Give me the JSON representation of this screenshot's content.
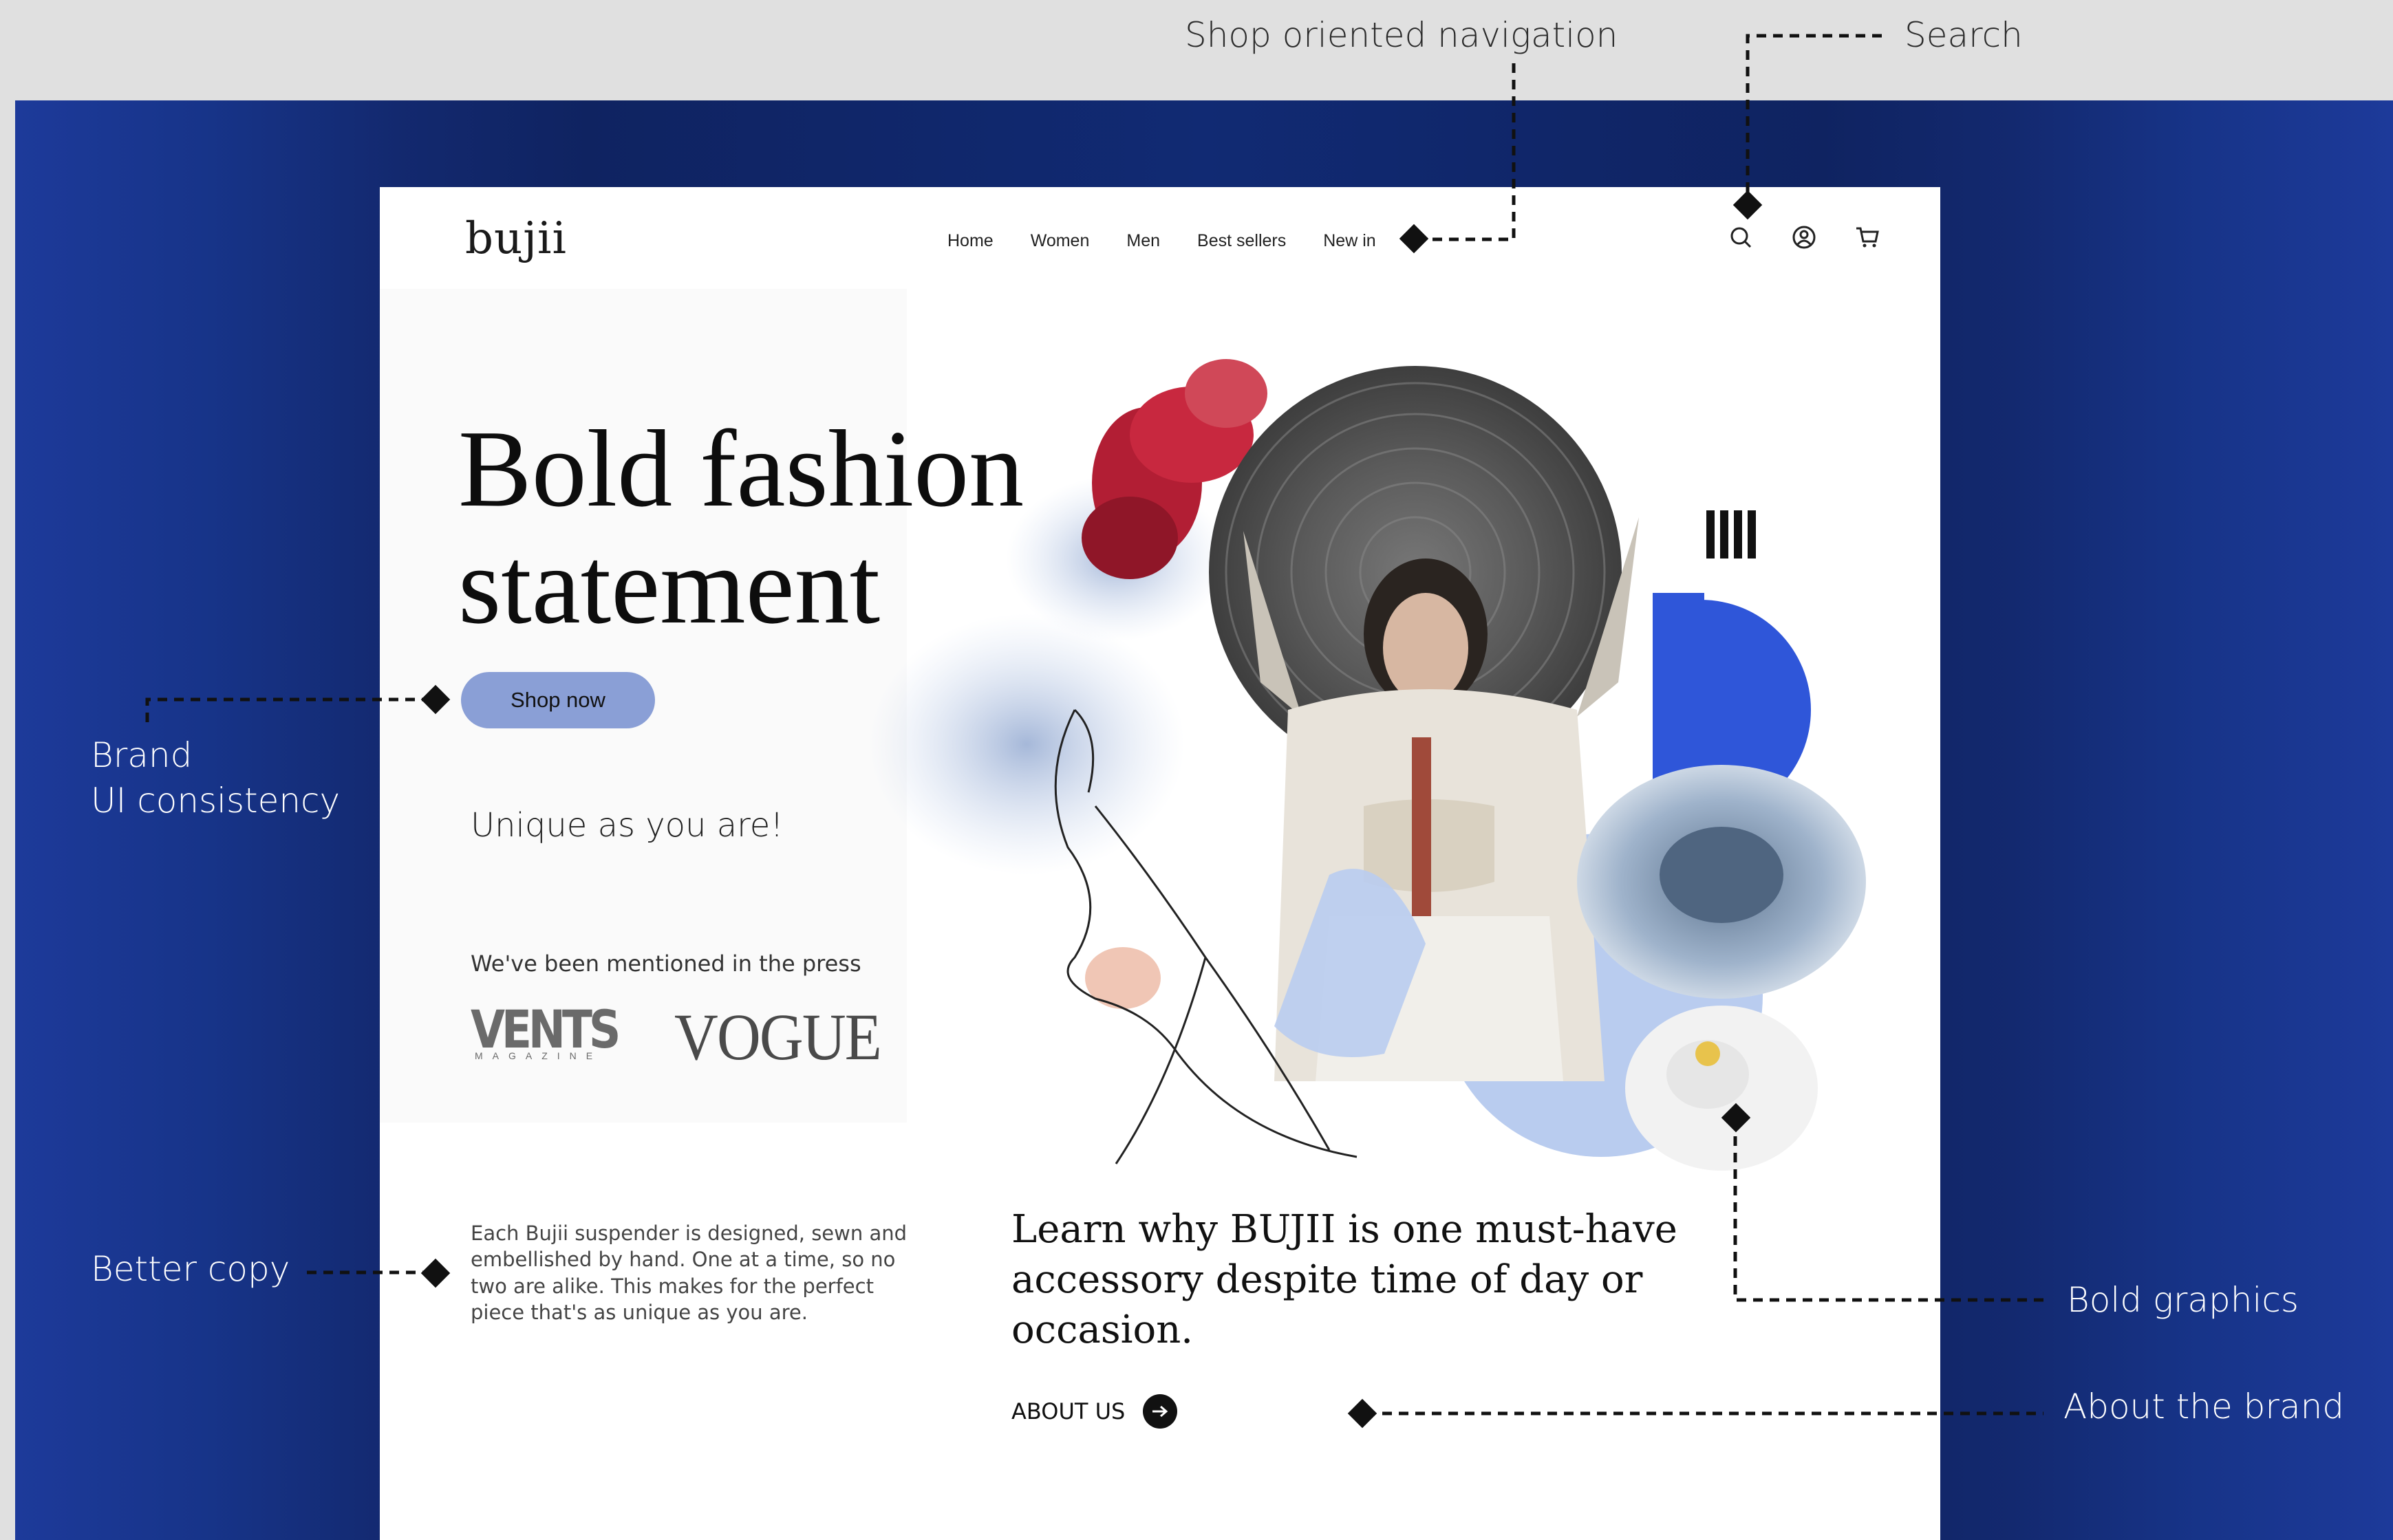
{
  "annotations": {
    "shop_nav": "Shop oriented navigation",
    "search": "Search",
    "brand_line1": "Brand",
    "brand_line2": "UI consistency",
    "better_copy": "Better copy",
    "bold_graphics": "Bold graphics",
    "about_brand": "About the brand"
  },
  "site": {
    "logo": "bujii",
    "nav": [
      "Home",
      "Women",
      "Men",
      "Best sellers",
      "New in"
    ],
    "icons": [
      "search-icon",
      "user-icon",
      "cart-icon"
    ],
    "hero": {
      "headline_line1": "Bold fashion",
      "headline_line2": "statement",
      "cta": "Shop now",
      "tagline": "Unique as you are!",
      "press_label": "We've been mentioned in the press",
      "press_logos": [
        "VENTS",
        "VOGUE"
      ],
      "vents_sub": "MAGAZINE"
    },
    "copy": "Each Bujii suspender is designed, sewn and embellished by hand. One at a time, so no two are alike. This makes for the perfect piece that's as unique as you are.",
    "learn": "Learn why BUJII is one must-have accessory despite time of day or occasion.",
    "about_cta": "ABOUT US"
  },
  "colors": {
    "background_band": "#e0e0e0",
    "page_blue": "#13296f",
    "cta_fill": "#8a9fd6",
    "accent_blue": "#2f56d9",
    "light_blue": "#b9ccef"
  }
}
